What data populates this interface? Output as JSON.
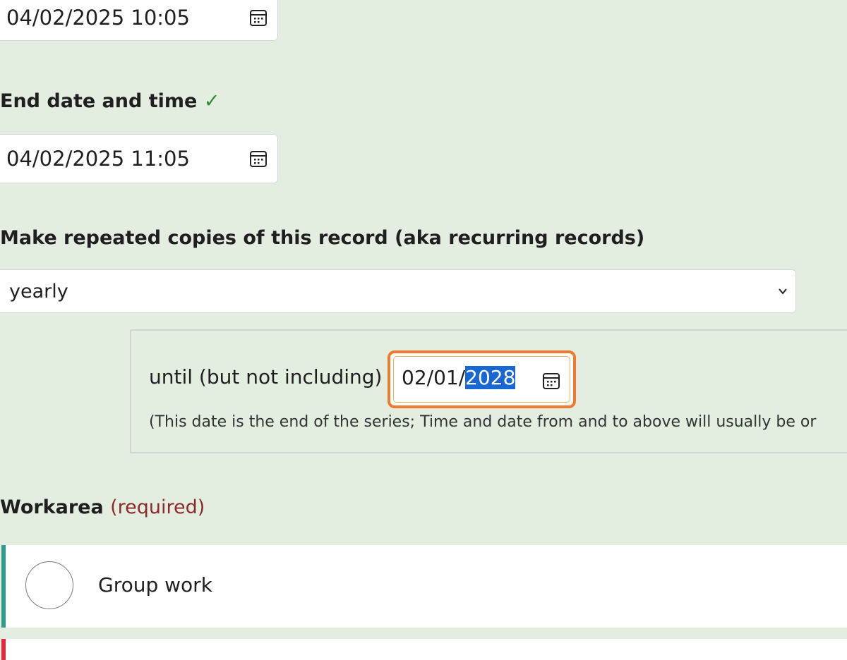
{
  "start": {
    "value": "04/02/2025 10:05",
    "icon": "calendar-icon"
  },
  "end": {
    "label": "End date and time",
    "check": "✓",
    "value": "04/02/2025 11:05",
    "icon": "calendar-icon"
  },
  "recurrence": {
    "label": "Make repeated copies of this record (aka recurring records)",
    "selected": "yearly",
    "icon": "chevron-down-icon",
    "until_label": "until (but not including)",
    "until_prefix": "02/01/",
    "until_selected": "2028",
    "until_icon": "calendar-icon",
    "hint": "(This date is the end of the series; Time and date from and to above will usually be or"
  },
  "workarea": {
    "label": "Workarea",
    "required": "(required)",
    "options": [
      {
        "label": "Group work",
        "accent": "#2e9e8c"
      }
    ],
    "next_accent": "#e8273f"
  },
  "colors": {
    "background": "#e3eee1",
    "focus_outline": "#f07a30",
    "selection": "#1967d2",
    "check": "#2d8a2d",
    "required": "#8c2a2a"
  }
}
